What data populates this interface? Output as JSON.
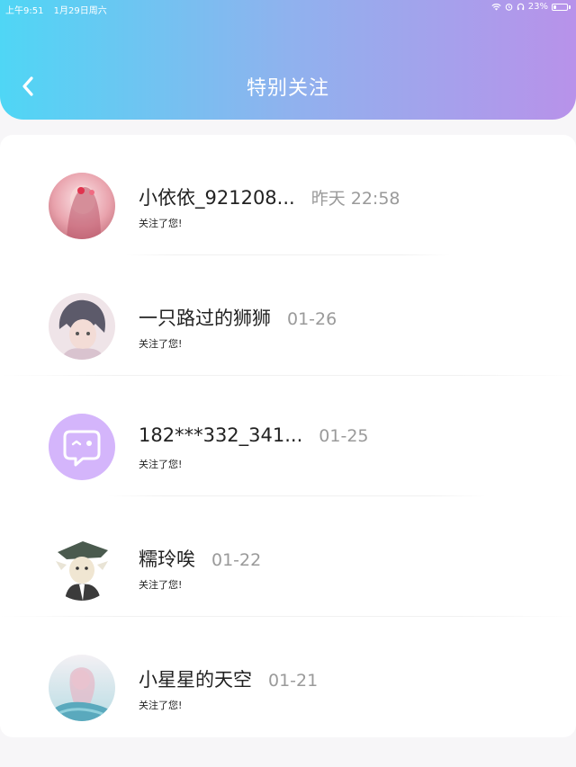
{
  "status_bar": {
    "time": "上午9:51",
    "date": "1月29日周六",
    "battery": "23%",
    "battery_level": 0.23
  },
  "header": {
    "title": "特别关注",
    "back_icon": "chevron-left-icon",
    "gradient": [
      "#4fd6f5",
      "#8fb2ee",
      "#b892ea"
    ]
  },
  "list": [
    {
      "name": "小依依_921208...",
      "time": "昨天 22:58",
      "action": "关注了您!"
    },
    {
      "name": "一只路过的狮狮",
      "time": "01-26",
      "action": "关注了您!"
    },
    {
      "name": "182***332_341...",
      "time": "01-25",
      "action": "关注了您!"
    },
    {
      "name": "糯玲唉",
      "time": "01-22",
      "action": "关注了您!"
    },
    {
      "name": "小星星的天空",
      "time": "01-21",
      "action": "关注了您!"
    }
  ]
}
